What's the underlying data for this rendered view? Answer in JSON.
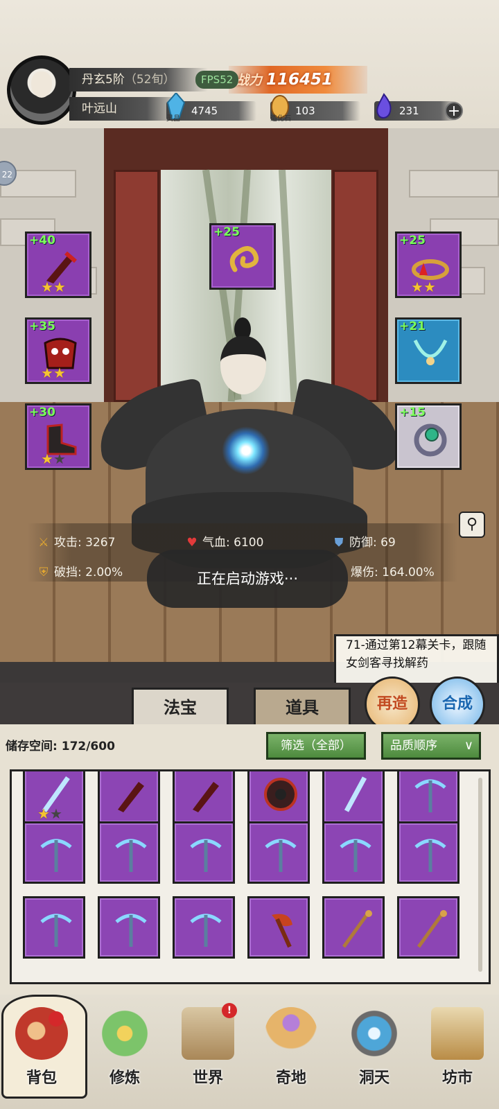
{
  "header": {
    "realm": "丹玄5阶",
    "realm_sub": "（52旬）",
    "player_name": "叶远山",
    "fps": "FPS52",
    "power_label": "战力",
    "power_value": "116451",
    "resources": [
      {
        "name": "灵晶",
        "value": "4745",
        "color": "#3fa4d6",
        "icon": "crystal-icon"
      },
      {
        "name": "造化石",
        "value": "103",
        "color": "#e8a23c",
        "icon": "stone-icon"
      },
      {
        "name": "",
        "value": "231",
        "color": "#5c45d8",
        "icon": "spirit-flame-icon"
      }
    ],
    "add_label": "+"
  },
  "side_bubble": "22",
  "equipment": {
    "left": [
      {
        "level": "+40",
        "stars": 2,
        "max_stars": 2,
        "rarity": "purple",
        "icon": "dagger-icon"
      },
      {
        "level": "+35",
        "stars": 2,
        "max_stars": 2,
        "rarity": "purple",
        "icon": "demon-armor-icon"
      },
      {
        "level": "+30",
        "stars": 1,
        "max_stars": 2,
        "rarity": "purple",
        "icon": "boots-icon"
      }
    ],
    "center": {
      "level": "+25",
      "rarity": "purple",
      "icon": "golden-ornament-icon"
    },
    "right": [
      {
        "level": "+25",
        "stars": 2,
        "max_stars": 2,
        "rarity": "purple",
        "icon": "crown-ring-icon"
      },
      {
        "level": "+21",
        "rarity": "blue",
        "icon": "necklace-icon"
      },
      {
        "level": "+15",
        "rarity": "white",
        "icon": "jade-ring-icon"
      }
    ]
  },
  "stats": {
    "attack_label": "攻击:",
    "attack": "3267",
    "hp_label": "气血:",
    "hp": "6100",
    "defense_label": "防御:",
    "defense": "69",
    "block_break_label": "破挡:",
    "block_break": "2.00%",
    "crit_dmg_label": "爆伤:",
    "crit_dmg": "164.00%"
  },
  "toast": "正在启动游戏···",
  "quest": "71-通过第12幕关卡，跟随女剑客寻找解药",
  "tabs": {
    "fabao": "法宝",
    "daoju": "道具"
  },
  "actions": {
    "rebuild": "再造",
    "combine": "合成"
  },
  "storage": {
    "label": "储存空间:",
    "used": "172/600",
    "filter": "筛选（全部）",
    "sort": "品质顺序",
    "sort_chevron": "∨"
  },
  "inventory": [
    {
      "icon": "sword-icon",
      "stars": 1,
      "max_stars": 2
    },
    {
      "icon": "dagger-icon"
    },
    {
      "icon": "dagger-icon"
    },
    {
      "icon": "saw-wheel-icon"
    },
    {
      "icon": "sword-icon"
    },
    {
      "icon": "crossbow-icon"
    },
    {
      "icon": "crossbow-icon"
    },
    {
      "icon": "crossbow-icon"
    },
    {
      "icon": "crossbow-icon"
    },
    {
      "icon": "crossbow-icon"
    },
    {
      "icon": "crossbow-icon"
    },
    {
      "icon": "crossbow-icon"
    },
    {
      "icon": "crossbow-icon"
    },
    {
      "icon": "crossbow-icon"
    },
    {
      "icon": "crossbow-icon"
    },
    {
      "icon": "axe-icon"
    },
    {
      "icon": "staff-icon"
    },
    {
      "icon": "staff-icon"
    }
  ],
  "nav": [
    {
      "label": "背包",
      "icon": "bag-icon",
      "active": true
    },
    {
      "label": "修炼",
      "icon": "lotus-icon"
    },
    {
      "label": "世界",
      "icon": "scroll-map-icon",
      "badge": "!"
    },
    {
      "label": "奇地",
      "icon": "floating-island-icon"
    },
    {
      "label": "洞天",
      "icon": "portal-icon"
    },
    {
      "label": "坊市",
      "icon": "market-chest-icon"
    }
  ],
  "colors": {
    "purple": "#8c45b4",
    "blue": "#2c8cc0",
    "white": "#c9c4cf",
    "level": "#7cff5a",
    "star": "#f5c431"
  }
}
